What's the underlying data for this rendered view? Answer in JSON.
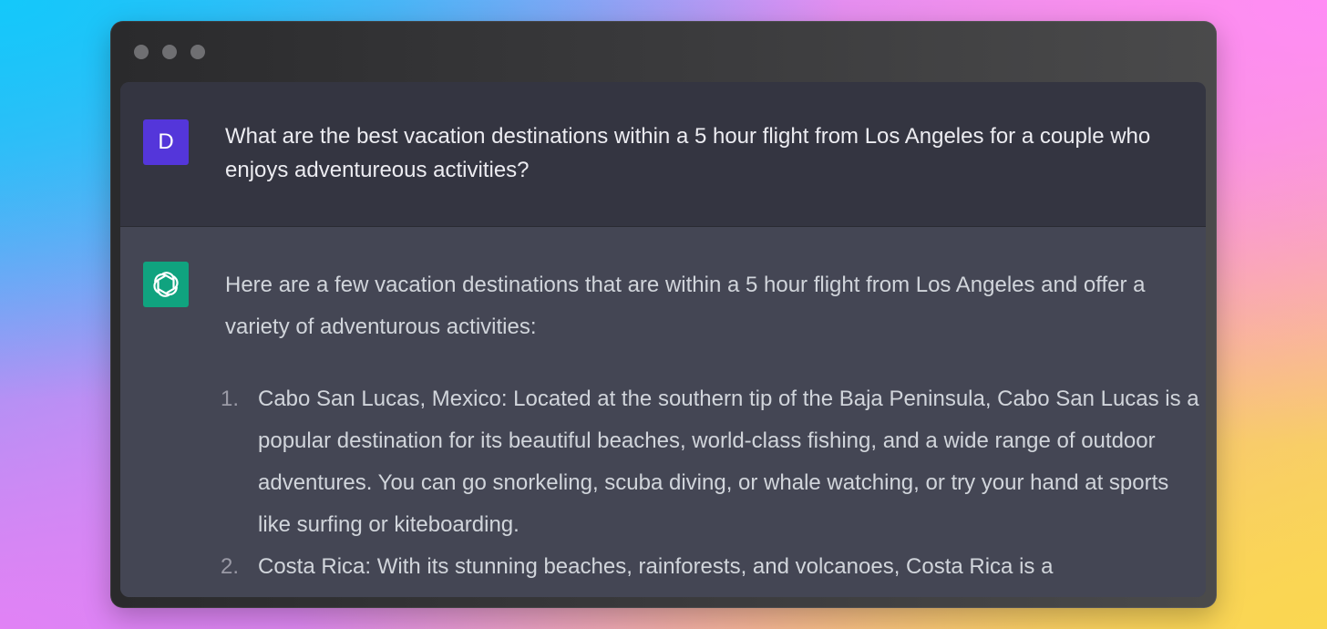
{
  "user": {
    "avatar_initial": "D",
    "message": "What are the best vacation destinations within a 5 hour flight from Los Angeles for a couple who enjoys adventureous activities?"
  },
  "assistant": {
    "avatar_icon": "openai-logo-icon",
    "intro": "Here are a few vacation destinations that are within a 5 hour flight from Los Angeles and offer a variety of adventurous activities:",
    "items": [
      {
        "number": "1.",
        "text": "Cabo San Lucas, Mexico: Located at the southern tip of the Baja Peninsula, Cabo San Lucas is a popular destination for its beautiful beaches, world-class fishing, and a wide range of outdoor adventures. You can go snorkeling, scuba diving, or whale watching, or try your hand at sports like surfing or kiteboarding."
      },
      {
        "number": "2.",
        "text": "Costa Rica: With its stunning beaches, rainforests, and volcanoes, Costa Rica is a"
      }
    ]
  },
  "colors": {
    "user_avatar": "#5436da",
    "assistant_avatar": "#10a37f",
    "user_row_bg": "#343541",
    "assistant_row_bg": "#444654"
  }
}
